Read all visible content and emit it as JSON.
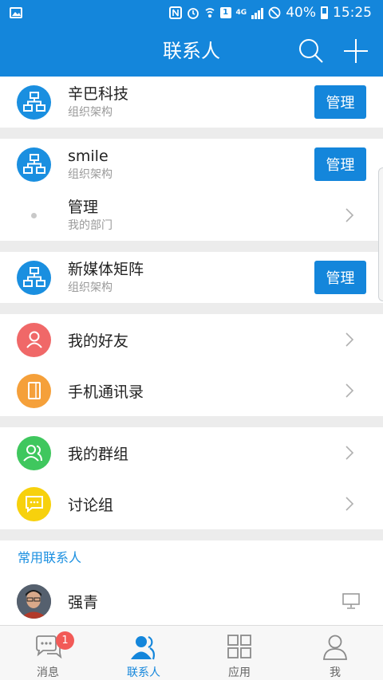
{
  "status_bar": {
    "battery": "40%",
    "time": "15:25",
    "network": "4G",
    "sim_slot": "1"
  },
  "header": {
    "title": "联系人"
  },
  "orgs": [
    {
      "name": "辛巴科技",
      "subtitle": "组织架构",
      "button": "管理"
    },
    {
      "name": "smile",
      "subtitle": "组织架构",
      "button": "管理"
    },
    {
      "name": "新媒体矩阵",
      "subtitle": "组织架构",
      "button": "管理"
    }
  ],
  "department": {
    "name": "管理",
    "subtitle": "我的部门"
  },
  "personal_links": [
    {
      "label": "我的好友",
      "icon": "person-icon",
      "color": "#f06868"
    },
    {
      "label": "手机通讯录",
      "icon": "book-icon",
      "color": "#f5a03a"
    }
  ],
  "group_links": [
    {
      "label": "我的群组",
      "icon": "group-icon",
      "color": "#3fc75e"
    },
    {
      "label": "讨论组",
      "icon": "chat-icon",
      "color": "#f7d10d"
    }
  ],
  "frequent": {
    "header": "常用联系人",
    "contacts": [
      {
        "name": "强青"
      }
    ]
  },
  "tabs": [
    {
      "label": "消息",
      "badge": "1"
    },
    {
      "label": "联系人"
    },
    {
      "label": "应用"
    },
    {
      "label": "我"
    }
  ],
  "colors": {
    "brand": "#1486db",
    "badge": "#f25a57"
  }
}
